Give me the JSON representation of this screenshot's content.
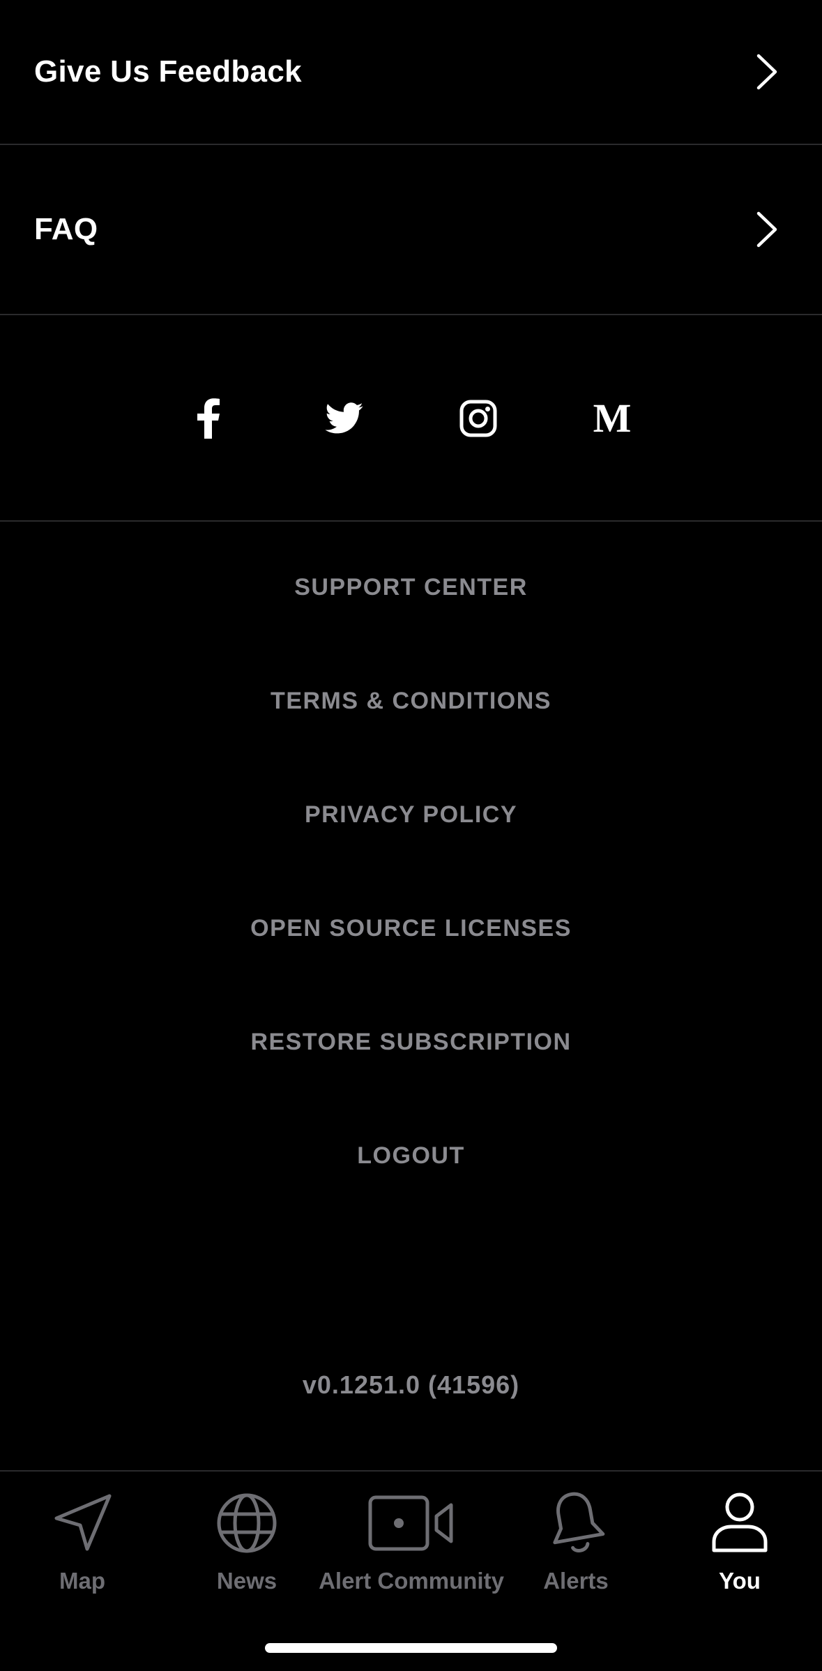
{
  "menu": {
    "feedback_label": "Give Us Feedback",
    "faq_label": "FAQ"
  },
  "social": {
    "icons": [
      "facebook-icon",
      "twitter-icon",
      "instagram-icon",
      "medium-icon"
    ],
    "medium_glyph": "M"
  },
  "links": {
    "support_center": "SUPPORT CENTER",
    "terms": "TERMS & CONDITIONS",
    "privacy": "PRIVACY POLICY",
    "open_source": "OPEN SOURCE LICENSES",
    "restore_subscription": "RESTORE SUBSCRIPTION",
    "logout": "LOGOUT"
  },
  "version": "v0.1251.0 (41596)",
  "tabbar": {
    "active_tab": "You",
    "tabs": [
      {
        "label": "Map",
        "icon": "navigation-arrow-icon"
      },
      {
        "label": "News",
        "icon": "globe-icon"
      },
      {
        "label": "Alert Community",
        "icon": "video-camera-icon"
      },
      {
        "label": "Alerts",
        "icon": "bell-icon"
      },
      {
        "label": "You",
        "icon": "person-icon"
      }
    ]
  },
  "colors": {
    "background": "#000000",
    "primary_text": "#ffffff",
    "secondary_text": "#8b8b90",
    "inactive_tab": "#6e6e73",
    "divider": "#2a2a2c"
  }
}
